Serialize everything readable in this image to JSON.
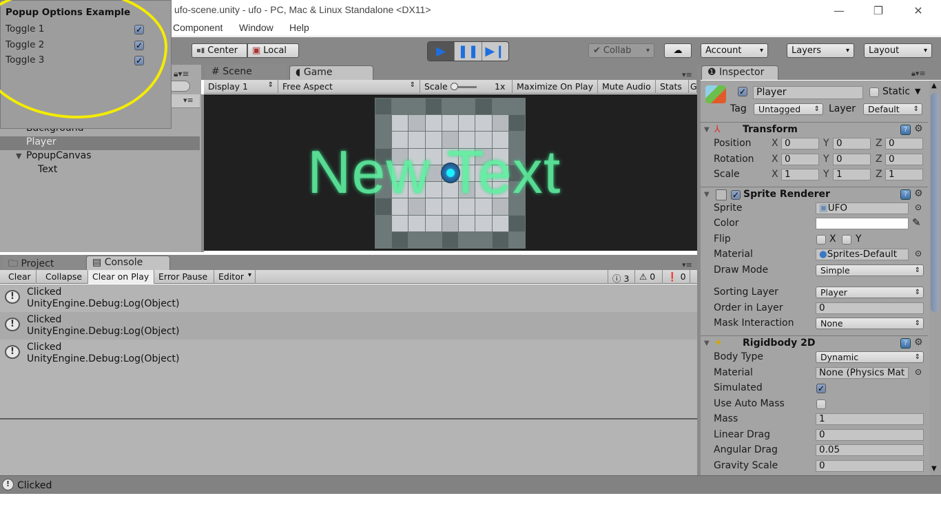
{
  "window": {
    "title": "ufo-scene.unity - ufo - PC, Mac & Linux Standalone <DX11>",
    "minimize_icon": "minimize-icon",
    "maximize_icon": "restore-icon",
    "close_icon": "close-icon"
  },
  "menu": {
    "items": [
      "Component",
      "Window",
      "Help"
    ]
  },
  "toolbar": {
    "pivot_label": "Center",
    "space_label": "Local",
    "collab_label": "Collab",
    "account_label": "Account",
    "layers_label": "Layers",
    "layout_label": "Layout",
    "play_state": "playing"
  },
  "popup": {
    "title": "Popup Options Example",
    "toggles": [
      {
        "label": "Toggle 1",
        "checked": true
      },
      {
        "label": "Toggle 2",
        "checked": true
      },
      {
        "label": "Toggle 3",
        "checked": true
      }
    ]
  },
  "hierarchy": {
    "items": [
      {
        "label": "Background",
        "indent": 1,
        "selected": false
      },
      {
        "label": "Player",
        "indent": 1,
        "selected": true
      },
      {
        "label": "PopupCanvas",
        "indent": 1,
        "expanded": true,
        "selected": false
      },
      {
        "label": "Text",
        "indent": 2,
        "selected": false
      }
    ]
  },
  "game": {
    "tabs": [
      {
        "label": "Scene",
        "icon": "scene-grid-icon",
        "active": false
      },
      {
        "label": "Game",
        "icon": "game-pacman-icon",
        "active": true
      }
    ],
    "display": "Display 1",
    "aspect": "Free Aspect",
    "scale_label": "Scale",
    "scale_value": "1x",
    "maximize_on_play": "Maximize On Play",
    "mute_audio": "Mute Audio",
    "stats": "Stats",
    "gizmos": "G",
    "overlay_text": "New Text"
  },
  "bottom_tabs": [
    {
      "label": "Project",
      "icon": "folder-icon",
      "active": false
    },
    {
      "label": "Console",
      "icon": "console-icon",
      "active": true
    }
  ],
  "console": {
    "buttons": [
      "Clear",
      "Collapse",
      "Clear on Play",
      "Error Pause",
      "Editor"
    ],
    "counts": {
      "info": "3",
      "warnings": "0",
      "errors": "0"
    },
    "entries": [
      {
        "line1": "Clicked",
        "line2": "UnityEngine.Debug:Log(Object)"
      },
      {
        "line1": "Clicked",
        "line2": "UnityEngine.Debug:Log(Object)"
      },
      {
        "line1": "Clicked",
        "line2": "UnityEngine.Debug:Log(Object)"
      }
    ]
  },
  "status_bar": {
    "message": "Clicked"
  },
  "inspector": {
    "tab_label": "Inspector",
    "object": {
      "active": true,
      "name": "Player",
      "static_label": "Static",
      "static": false,
      "tag_label": "Tag",
      "tag": "Untagged",
      "layer_label": "Layer",
      "layer": "Default"
    },
    "transform": {
      "title": "Transform",
      "rows": [
        {
          "label": "Position",
          "x": "0",
          "y": "0",
          "z": "0"
        },
        {
          "label": "Rotation",
          "x": "0",
          "y": "0",
          "z": "0"
        },
        {
          "label": "Scale",
          "x": "1",
          "y": "1",
          "z": "1"
        }
      ]
    },
    "sprite_renderer": {
      "title": "Sprite Renderer",
      "enabled": true,
      "sprite_label": "Sprite",
      "sprite": "UFO",
      "color_label": "Color",
      "color": "#ffffff",
      "flip_label": "Flip",
      "flip_x": false,
      "flip_y": false,
      "material_label": "Material",
      "material": "Sprites-Default",
      "draw_mode_label": "Draw Mode",
      "draw_mode": "Simple",
      "sorting_layer_label": "Sorting Layer",
      "sorting_layer": "Player",
      "order_label": "Order in Layer",
      "order": "0",
      "mask_label": "Mask Interaction",
      "mask": "None"
    },
    "rigidbody": {
      "title": "Rigidbody 2D",
      "body_type_label": "Body Type",
      "body_type": "Dynamic",
      "material_label": "Material",
      "material": "None (Physics Mat",
      "simulated_label": "Simulated",
      "simulated": true,
      "auto_mass_label": "Use Auto Mass",
      "auto_mass": false,
      "mass_label": "Mass",
      "mass": "1",
      "linear_drag_label": "Linear Drag",
      "linear_drag": "0",
      "angular_drag_label": "Angular Drag",
      "angular_drag": "0.05",
      "gravity_label": "Gravity Scale",
      "gravity": "0"
    }
  }
}
